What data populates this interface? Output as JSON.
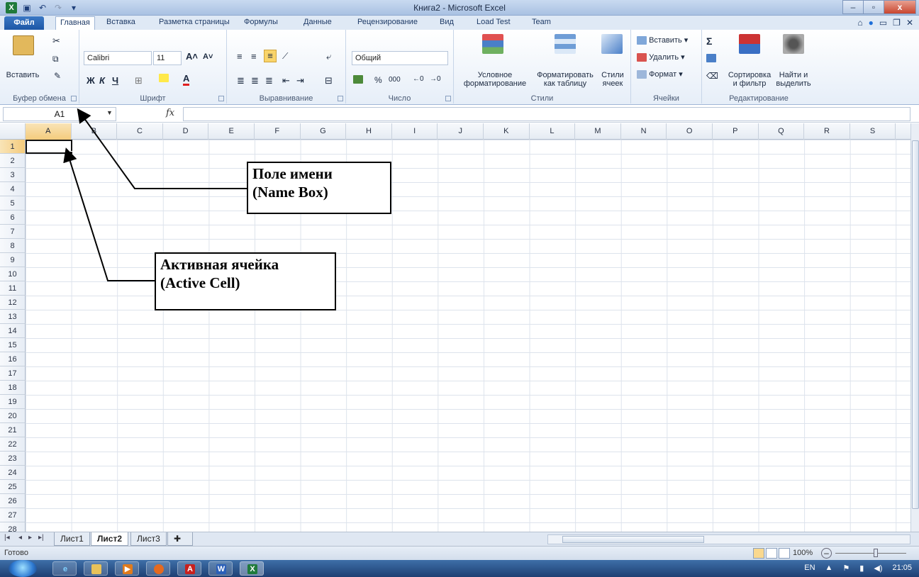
{
  "window": {
    "title": "Книга2 - Microsoft Excel",
    "controls": {
      "minimize": "–",
      "restore": "▫",
      "close": "x"
    }
  },
  "ribbon_tabs": [
    "Файл",
    "Главная",
    "Вставка",
    "Разметка страницы",
    "Формулы",
    "Данные",
    "Рецензирование",
    "Вид",
    "Load Test",
    "Team"
  ],
  "ribbon": {
    "clipboard": {
      "paste": "Вставить",
      "label": "Буфер обмена"
    },
    "font": {
      "name": "Calibri",
      "size": "11",
      "bold": "Ж",
      "italic": "К",
      "underline": "Ч",
      "label": "Шрифт"
    },
    "alignment": {
      "label": "Выравнивание"
    },
    "number": {
      "format": "Общий",
      "percent": "%",
      "thousands": "000",
      "label": "Число"
    },
    "styles": {
      "conditional": "Условное",
      "conditional2": "форматирование",
      "as_table": "Форматировать",
      "as_table2": "как таблицу",
      "cell_styles": "Стили",
      "cell_styles2": "ячеек",
      "label": "Стили"
    },
    "cells": {
      "insert": "Вставить",
      "delete": "Удалить",
      "format": "Формат",
      "label": "Ячейки"
    },
    "editing": {
      "sigma": "Σ",
      "sort": "Сортировка",
      "sort2": "и фильтр",
      "find": "Найти и",
      "find2": "выделить",
      "label": "Редактирование"
    }
  },
  "formula_bar": {
    "name_box": "A1",
    "fx": "fx",
    "value": ""
  },
  "columns": [
    "A",
    "B",
    "C",
    "D",
    "E",
    "F",
    "G",
    "H",
    "I",
    "J",
    "K",
    "L",
    "M",
    "N",
    "O",
    "P",
    "Q",
    "R",
    "S"
  ],
  "rows": [
    "1",
    "2",
    "3",
    "4",
    "5",
    "6",
    "7",
    "8",
    "9",
    "10",
    "11",
    "12",
    "13",
    "14",
    "15",
    "16",
    "17",
    "18",
    "19",
    "20",
    "21",
    "22",
    "23",
    "24",
    "25",
    "26",
    "27",
    "28"
  ],
  "callouts": {
    "name_box": {
      "line1": "Поле имени",
      "line2": "(Name Box)"
    },
    "active_cell": {
      "line1": "Активная ячейка",
      "line2": "(Active Cell)"
    }
  },
  "sheets": [
    "Лист1",
    "Лист2",
    "Лист3"
  ],
  "active_sheet": "Лист2",
  "status": {
    "ready": "Готово",
    "zoom": "100%"
  },
  "taskbar": {
    "lang": "EN",
    "time": "21:05"
  }
}
